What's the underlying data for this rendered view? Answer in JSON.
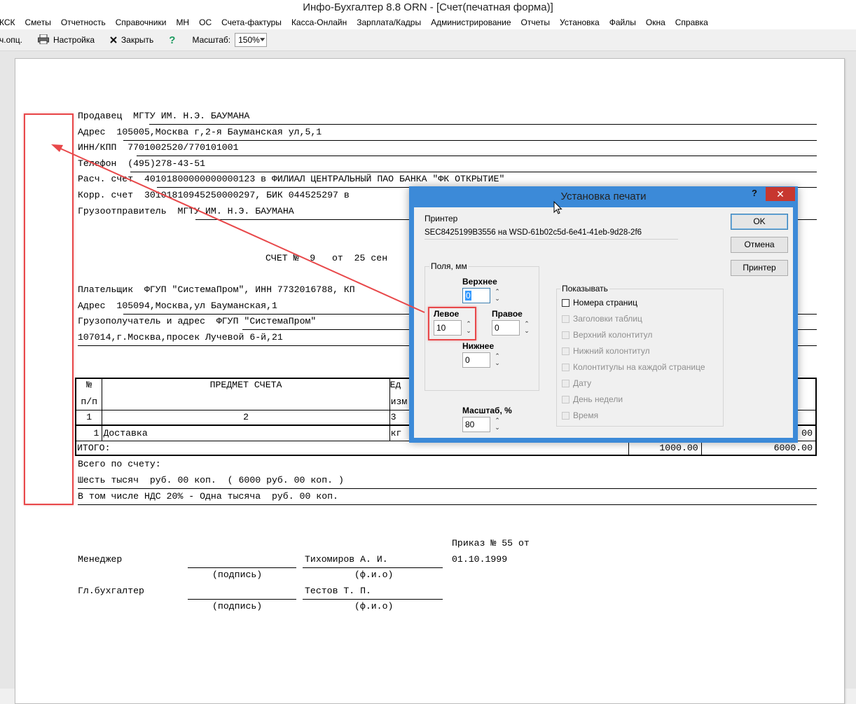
{
  "window": {
    "title": "Инфо-Бухгалтер 8.8   ORN    - [Счет(печатная форма)]"
  },
  "menu": [
    "КСК",
    "Сметы",
    "Отчетность",
    "Справочники",
    "МН",
    "ОС",
    "Счета-фактуры",
    "Касса-Онлайн",
    "Зарплата/Кадры",
    "Администрирование",
    "Отчеты",
    "Установка",
    "Файлы",
    "Окна",
    "Справка"
  ],
  "toolbar": {
    "opts_label": "ч.опц.",
    "settings_label": "Настройка",
    "close_label": "Закрыть",
    "help_glyph": "?",
    "zoom_label": "Масштаб:",
    "zoom_value": "150%"
  },
  "invoice": {
    "seller_label": "Продавец",
    "seller_value": "МГТУ ИМ. Н.Э. БАУМАНА",
    "address_label": "Адрес",
    "seller_address": "105005,Москва г,2-я Бауманская ул,5,1",
    "inn_label": "ИНН/КПП",
    "seller_inn": "7701002520/770101001",
    "phone_label": "Телефон",
    "seller_phone": "(495)278-43-51",
    "account_label": "Расч. счет",
    "seller_account": "40101800000000000123 в ФИЛИАЛ ЦЕНТРАЛЬНЫЙ ПАО БАНКА \"ФК ОТКРЫТИЕ\"",
    "corr_label": "Корр. счет",
    "seller_corr": "30101810945250000297, БИК 044525297 в",
    "shipper_label": "Грузоотправитель",
    "shipper_value": "МГТУ ИМ. Н.Э. БАУМАНА",
    "title": "СЧЕТ №  9   от  25 сен",
    "payer_label": "Плательщик",
    "payer_value": "ФГУП \"СистемаПром\", ИНН 7732016788, КП",
    "payer_address_label": "Адрес",
    "payer_address": "105094,Москва,ул Бауманская,1",
    "consignee_label": "Грузополучатель и адрес",
    "consignee_value": "ФГУП \"СистемаПром\"",
    "consignee_address": "107014,г.Москва,просек Лучевой 6-й,21",
    "table": {
      "h_no_1": "№",
      "h_no_2": "п/п",
      "h_subject": "ПРЕДМЕТ СЧЕТА",
      "h_unit_1": "Ед",
      "h_unit_2": "изм",
      "n1": "1",
      "n2": "2",
      "n3": "3",
      "row_no": "1",
      "row_name": "Доставка",
      "row_unit": "кг",
      "row_tail": "00",
      "total_label": "ИТОГО:",
      "total_vat": "1000.00",
      "total_sum": "6000.00"
    },
    "total_line": "Всего по счету:",
    "total_words": "Шесть тысяч  руб. 00 коп.  ( 6000 руб. 00 коп. )",
    "vat_line": "В том числе НДС 20% - Одна тысяча  руб. 00 коп.",
    "order_line1": "Приказ № 55 от",
    "order_line2": "01.10.1999",
    "manager_label": "Менеджер",
    "manager_name": "Тихомиров А. И.",
    "sign_caption": "(подпись)",
    "fio_caption": "(ф.и.о)",
    "accountant_label": "Гл.бухгалтер",
    "accountant_name": "Тестов Т. П."
  },
  "dialog": {
    "title": "Установка печати",
    "help": "?",
    "close": "✕",
    "printer_label": "Принтер",
    "printer_value": "SEC8425199B3556 на WSD-61b02c5d-6e41-41eb-9d28-2f6",
    "margins_group": "Поля, мм",
    "top_label": "Верхнее",
    "top_value": "0",
    "left_label": "Левое",
    "left_value": "10",
    "right_label": "Правое",
    "right_value": "0",
    "bottom_label": "Нижнее",
    "bottom_value": "0",
    "scale_label": "Масштаб, %",
    "scale_value": "80",
    "ok": "OK",
    "cancel": "Отмена",
    "printer_button": "Принтер",
    "show_group": "Показывать",
    "show_options": [
      {
        "label": "Номера страниц",
        "enabled": true
      },
      {
        "label": "Заголовки таблиц",
        "enabled": false
      },
      {
        "label": "Верхний колонтитул",
        "enabled": false
      },
      {
        "label": "Нижний колонтитул",
        "enabled": false
      },
      {
        "label": "Колонтитулы на каждой странице",
        "enabled": false
      },
      {
        "label": "Дату",
        "enabled": false
      },
      {
        "label": "День недели",
        "enabled": false
      },
      {
        "label": "Время",
        "enabled": false
      }
    ]
  },
  "colors": {
    "highlight": "#e8484a",
    "dialog_border": "#3c8ad8",
    "close_button": "#c7372f"
  }
}
